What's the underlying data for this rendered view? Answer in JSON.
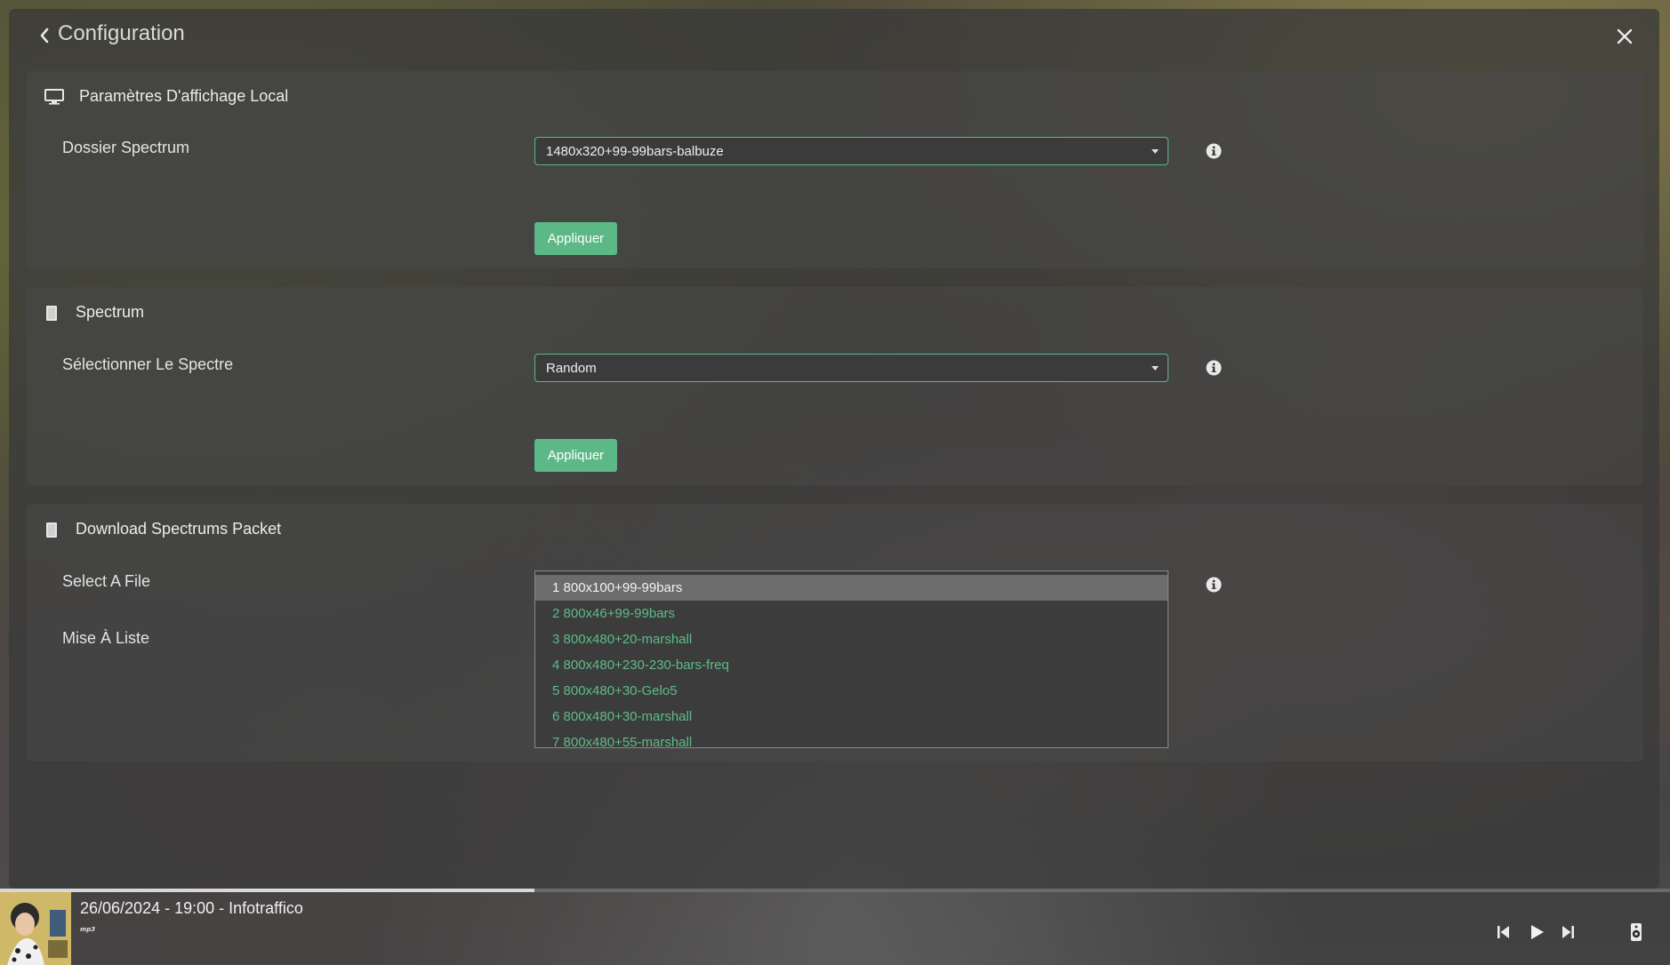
{
  "header": {
    "title": "Configuration"
  },
  "sections": [
    {
      "title": "Paramètres D'affichage Local",
      "field_label": "Dossier Spectrum",
      "select_value": "1480x320+99-99bars-balbuze",
      "apply_label": "Appliquer"
    },
    {
      "title": "Spectrum",
      "field_label": "Sélectionner Le Spectre",
      "select_value": "Random",
      "apply_label": "Appliquer"
    },
    {
      "title": "Download Spectrums Packet",
      "field_label": "Select A File",
      "field_label_2": "Mise À Liste",
      "dropdown_items": [
        "1 800x100+99-99bars",
        "2 800x46+99-99bars",
        "3 800x480+20-marshall",
        "4 800x480+230-230-bars-freq",
        "5 800x480+30-Gelo5",
        "6 800x480+30-marshall",
        "7 800x480+55-marshall"
      ],
      "selected_index": 0
    }
  ],
  "player": {
    "track_title": "26/06/2024 - 19:00 - Infotraffico",
    "format_badge": "mp3",
    "progress": 0.32
  },
  "colors": {
    "accent": "#5cb887",
    "dropdown_text": "#5dbc88",
    "panel": "#3a3a3a"
  },
  "icons": {
    "back": "chevron-left-icon",
    "close": "close-icon",
    "display": "monitor-icon",
    "spectrum": "file-icon",
    "info": "info-icon",
    "previous": "skip-previous-icon",
    "play": "play-icon",
    "next": "skip-next-icon",
    "output": "speaker-icon"
  }
}
